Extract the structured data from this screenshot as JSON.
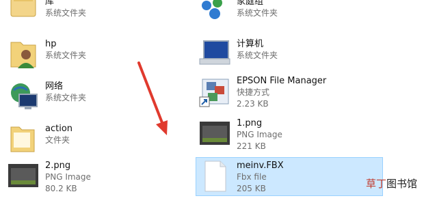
{
  "left_items": [
    {
      "name": "库",
      "sub1": "系统文件夹",
      "sub2": "",
      "icon": "library-icon"
    },
    {
      "name": "hp",
      "sub1": "系统文件夹",
      "sub2": "",
      "icon": "user-folder-icon"
    },
    {
      "name": "网络",
      "sub1": "系统文件夹",
      "sub2": "",
      "icon": "network-icon"
    },
    {
      "name": "action",
      "sub1": "文件夹",
      "sub2": "",
      "icon": "folder-icon"
    },
    {
      "name": "2.png",
      "sub1": "PNG Image",
      "sub2": "80.2 KB",
      "icon": "image-thumbnail-icon"
    }
  ],
  "right_items": [
    {
      "name": "家庭组",
      "sub1": "系统文件夹",
      "sub2": "",
      "icon": "homegroup-icon"
    },
    {
      "name": "计算机",
      "sub1": "系统文件夹",
      "sub2": "",
      "icon": "computer-icon"
    },
    {
      "name": "EPSON File Manager",
      "sub1": "快捷方式",
      "sub2": "2.23 KB",
      "icon": "epson-shortcut-icon"
    },
    {
      "name": "1.png",
      "sub1": "PNG Image",
      "sub2": "221 KB",
      "icon": "image-thumbnail-icon"
    },
    {
      "name": "meinv.FBX",
      "sub1": "Fbx file",
      "sub2": "205 KB",
      "icon": "blank-file-icon"
    }
  ],
  "watermark": {
    "part1": "草丁",
    "part2": "图书馆"
  },
  "colors": {
    "selection": "#cce8ff",
    "arrow": "#e03a2e",
    "folder": "#f2d27a"
  }
}
